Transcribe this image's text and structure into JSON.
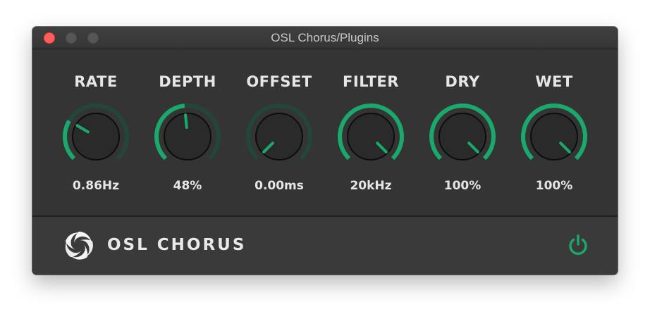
{
  "window": {
    "title": "OSL Chorus/Plugins"
  },
  "colors": {
    "accent": "#1aa86c",
    "track": "#24463a",
    "knob": "#2a2a2a",
    "panel": "#343434"
  },
  "knobs": [
    {
      "label": "RATE",
      "value": "0.86Hz",
      "fraction": 0.28
    },
    {
      "label": "DEPTH",
      "value": "48%",
      "fraction": 0.48
    },
    {
      "label": "OFFSET",
      "value": "0.00ms",
      "fraction": 0.0
    },
    {
      "label": "FILTER",
      "value": "20kHz",
      "fraction": 1.0
    },
    {
      "label": "DRY",
      "value": "100%",
      "fraction": 1.0
    },
    {
      "label": "WET",
      "value": "100%",
      "fraction": 1.0
    }
  ],
  "footer": {
    "brand": "OSL CHORUS",
    "logo_icon": "swirl-logo-icon",
    "power_icon": "power-icon"
  }
}
